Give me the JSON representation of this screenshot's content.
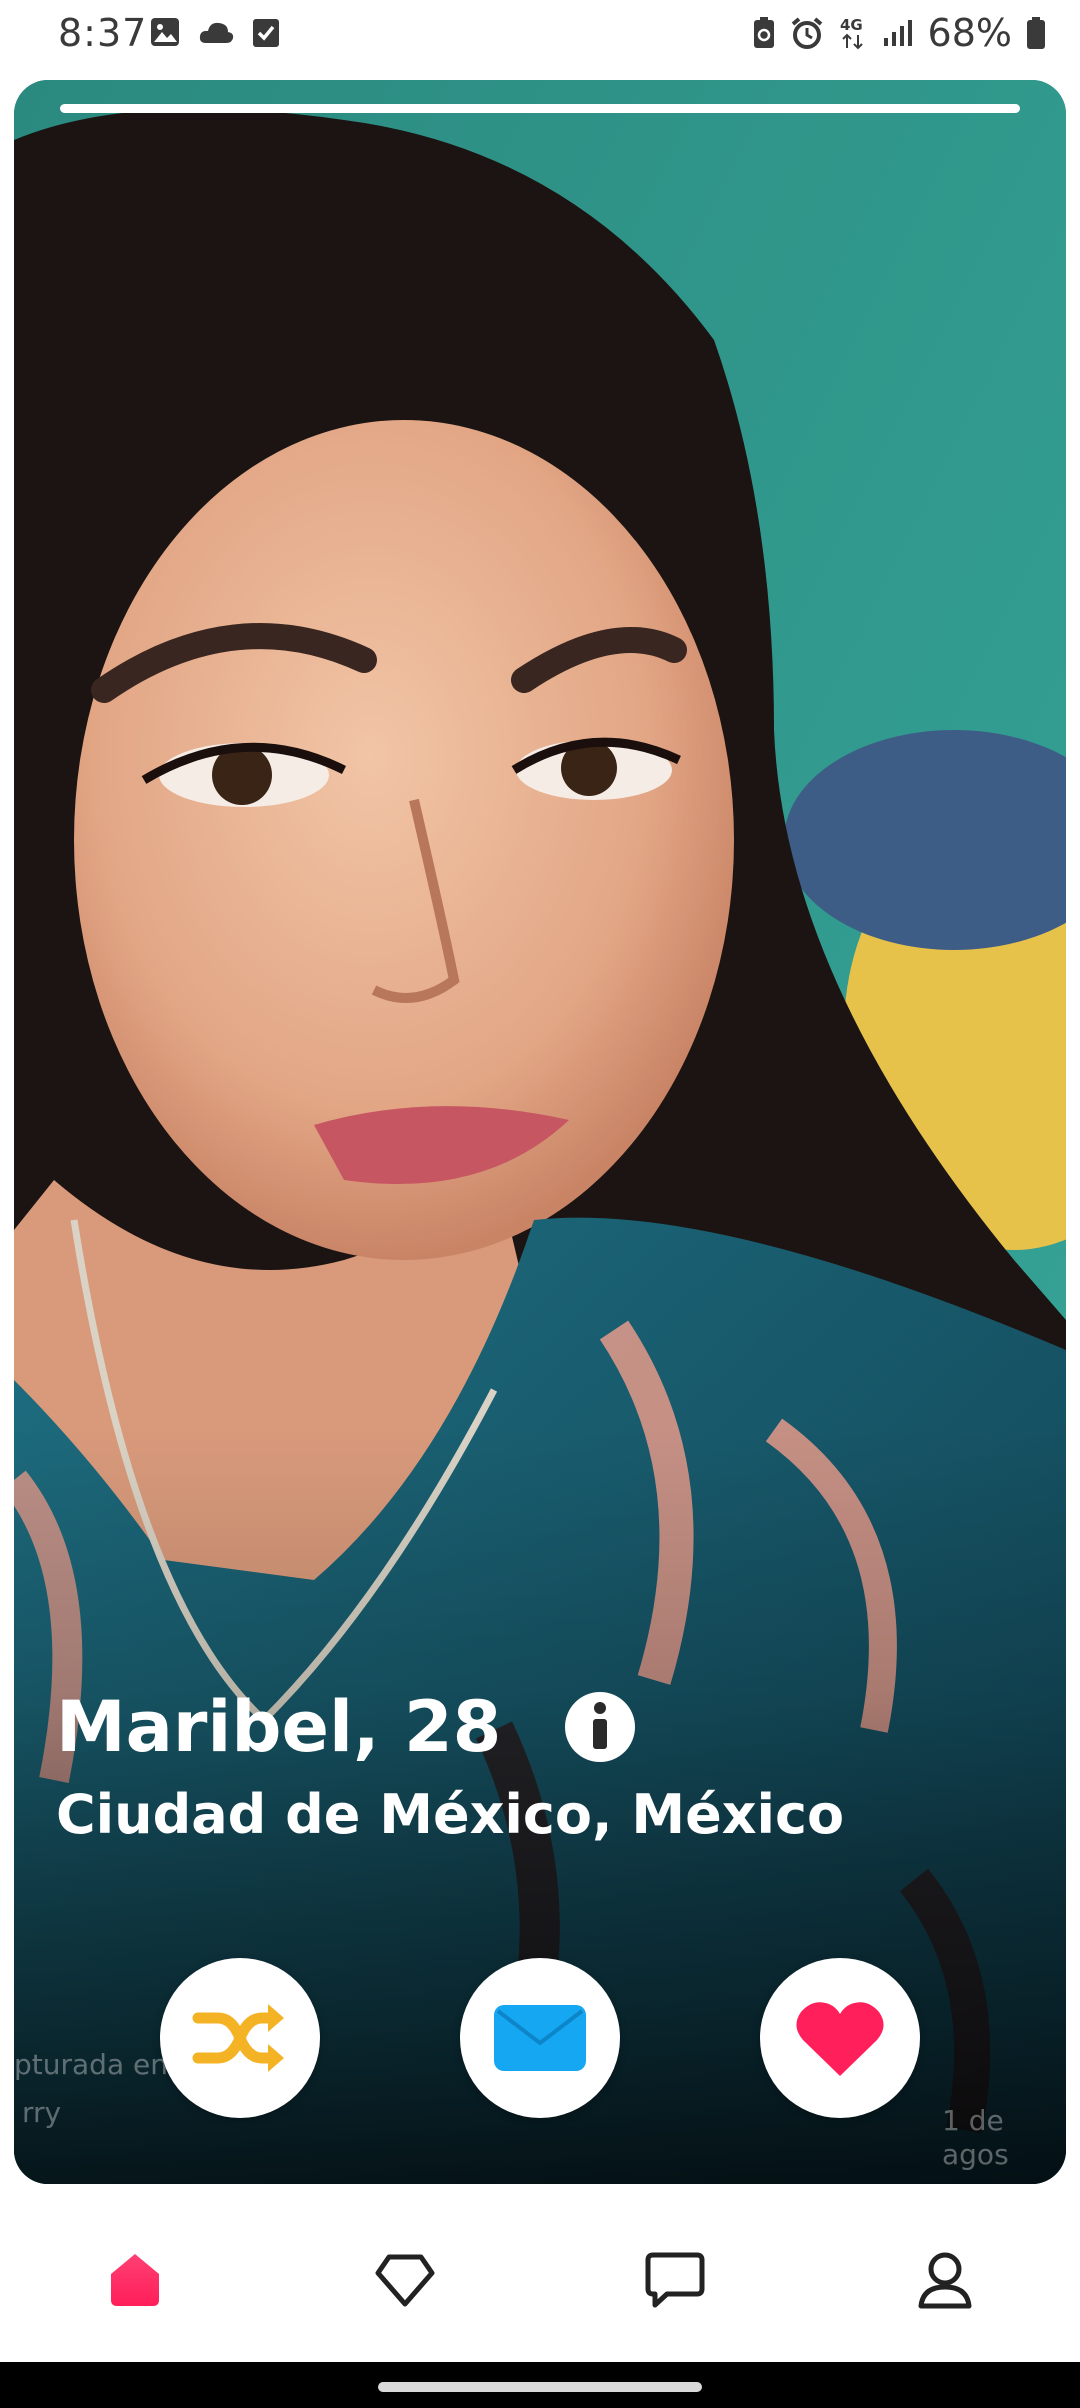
{
  "status_bar": {
    "time": "8:37",
    "battery_text": "68%",
    "network": "4G",
    "left_icons": [
      "photo-icon",
      "cloud-icon",
      "task-check-icon"
    ],
    "right_icons": [
      "battery-saver-icon",
      "alarm-icon",
      "network-4g-icon",
      "signal-icon",
      "battery-icon"
    ]
  },
  "profile": {
    "name_age": "Maribel, 28",
    "location": "Ciudad de México, México",
    "photo_progress": 1,
    "photo_background_color": "#2f8f86"
  },
  "faint_overlay_text": {
    "left_line1": "ptura​da en",
    "left_line2": "rry",
    "right": "1 de agos"
  },
  "actions": [
    {
      "icon": "shuffle-icon",
      "color": "#f4b324"
    },
    {
      "icon": "message-envelope-icon",
      "color": "#16a7f2"
    },
    {
      "icon": "heart-icon",
      "color": "#ff1f5a"
    }
  ],
  "bottom_nav": {
    "items": [
      "home-icon",
      "diamond-icon",
      "chat-icon",
      "profile-icon"
    ],
    "active": "home-icon",
    "active_color": "#ff1f5a"
  }
}
